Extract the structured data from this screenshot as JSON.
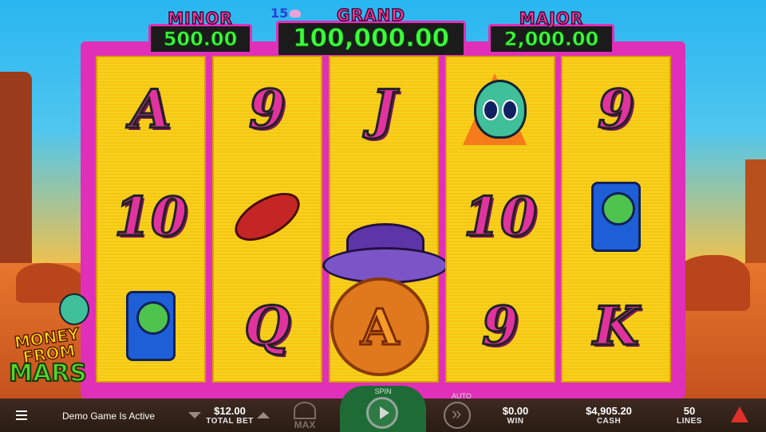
{
  "jackpots": {
    "minor": {
      "label": "MINOR",
      "value": "500.00"
    },
    "grand": {
      "label": "GRAND",
      "value": "100,000.00",
      "badge": "15"
    },
    "major": {
      "label": "MAJOR",
      "value": "2,000.00"
    }
  },
  "reels": [
    [
      "A",
      "10",
      "radio"
    ],
    [
      "9",
      "ray-gun",
      "Q"
    ],
    [
      "J",
      "ufo",
      "coin-A"
    ],
    [
      "alien",
      "10",
      "9"
    ],
    [
      "9",
      "radio",
      "K"
    ]
  ],
  "logo": {
    "line1": "MONEY FROM",
    "line2": "MARS"
  },
  "bottom_bar": {
    "demo_text": "Demo Game Is Active",
    "total_bet": {
      "value": "$12.00",
      "label": "TOTAL BET"
    },
    "max_label": "MAX",
    "spin_label": "SPIN",
    "auto_label": "AUTO",
    "win": {
      "value": "$0.00",
      "label": "WIN"
    },
    "cash": {
      "value": "$4,905.20",
      "label": "CASH"
    },
    "lines": {
      "value": "50",
      "label": "LINES"
    }
  },
  "colors": {
    "frame": "#e02fb8",
    "reel": "#f7d21e",
    "jackpot_text": "#3cff3c",
    "spin_panel": "#1f6b36"
  }
}
